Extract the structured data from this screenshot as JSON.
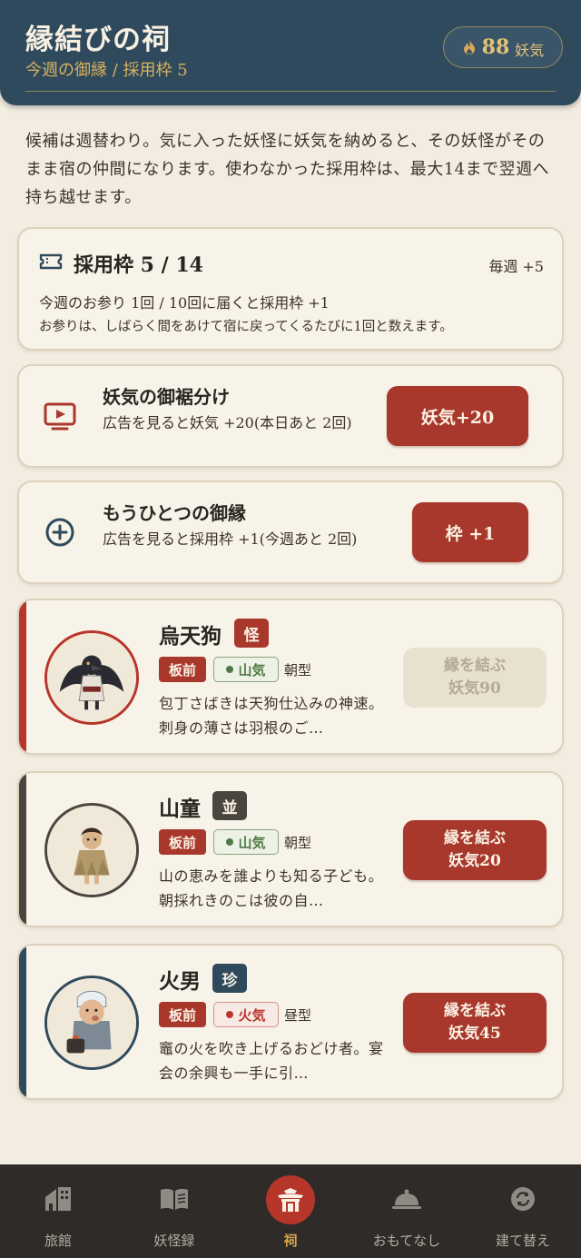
{
  "header": {
    "title": "縁結びの祠",
    "subtitle": "今週の御縁 / 採用枠 5",
    "yoki_amount": "88",
    "yoki_unit": "妖気"
  },
  "intro": "候補は週替わり。気に入った妖怪に妖気を納めると、その妖怪がそのまま宿の仲間になります。使わなかった採用枠は、最大14まで翌週へ持ち越せます。",
  "slots": {
    "title": "採用枠 5 / 14",
    "weekly": "毎週 +5",
    "progress": "今週のお参り 1回 / 10回に届くと採用枠 +1",
    "note": "お参りは、しばらく間をあけて宿に戻ってくるたびに1回と数えます。"
  },
  "offers": [
    {
      "title": "妖気の御裾分け",
      "desc": "広告を見ると妖気 +20(本日あと 2回)",
      "button": "妖気+20",
      "icon": "tv-icon"
    },
    {
      "title": "もうひとつの御縁",
      "desc": "広告を見ると採用枠 +1(今週あと 2回)",
      "button": "枠 +1",
      "icon": "plus-circle-icon"
    }
  ],
  "yokai": [
    {
      "name": "烏天狗",
      "rank": "怪",
      "rank_color": "#a8382c",
      "role": "板前",
      "qi": "山気",
      "qi_color": "#4f7a45",
      "type": "朝型",
      "desc": "包丁さばきは天狗仕込みの神速。刺身の薄さは羽根のご…",
      "bond_label": "縁を結ぶ",
      "cost": "妖気90",
      "affordable": false,
      "stripe_color": "#b8352b"
    },
    {
      "name": "山童",
      "rank": "並",
      "rank_color": "#4a453f",
      "role": "板前",
      "qi": "山気",
      "qi_color": "#4f7a45",
      "type": "朝型",
      "desc": "山の恵みを誰よりも知る子ども。朝採れきのこは彼の自…",
      "bond_label": "縁を結ぶ",
      "cost": "妖気20",
      "affordable": true,
      "stripe_color": "#4a453f"
    },
    {
      "name": "火男",
      "rank": "珍",
      "rank_color": "#2f4a5d",
      "role": "板前",
      "qi": "火気",
      "qi_color": "#b8352b",
      "type": "昼型",
      "desc": "竈の火を吹き上げるおどけ者。宴会の余興も一手に引…",
      "bond_label": "縁を結ぶ",
      "cost": "妖気45",
      "affordable": true,
      "stripe_color": "#2f4a5d"
    }
  ],
  "nav": [
    {
      "label": "旅館",
      "icon": "inn-icon",
      "active": false
    },
    {
      "label": "妖怪録",
      "icon": "book-icon",
      "active": false
    },
    {
      "label": "祠",
      "icon": "shrine-icon",
      "active": true
    },
    {
      "label": "おもてなし",
      "icon": "cloche-icon",
      "active": false
    },
    {
      "label": "建て替え",
      "icon": "rebuild-icon",
      "active": false
    }
  ],
  "colors": {
    "header_bg": "#2f4a5d",
    "accent_red": "#a8382c",
    "gold": "#d9b25f",
    "paper": "#f3ede1"
  }
}
